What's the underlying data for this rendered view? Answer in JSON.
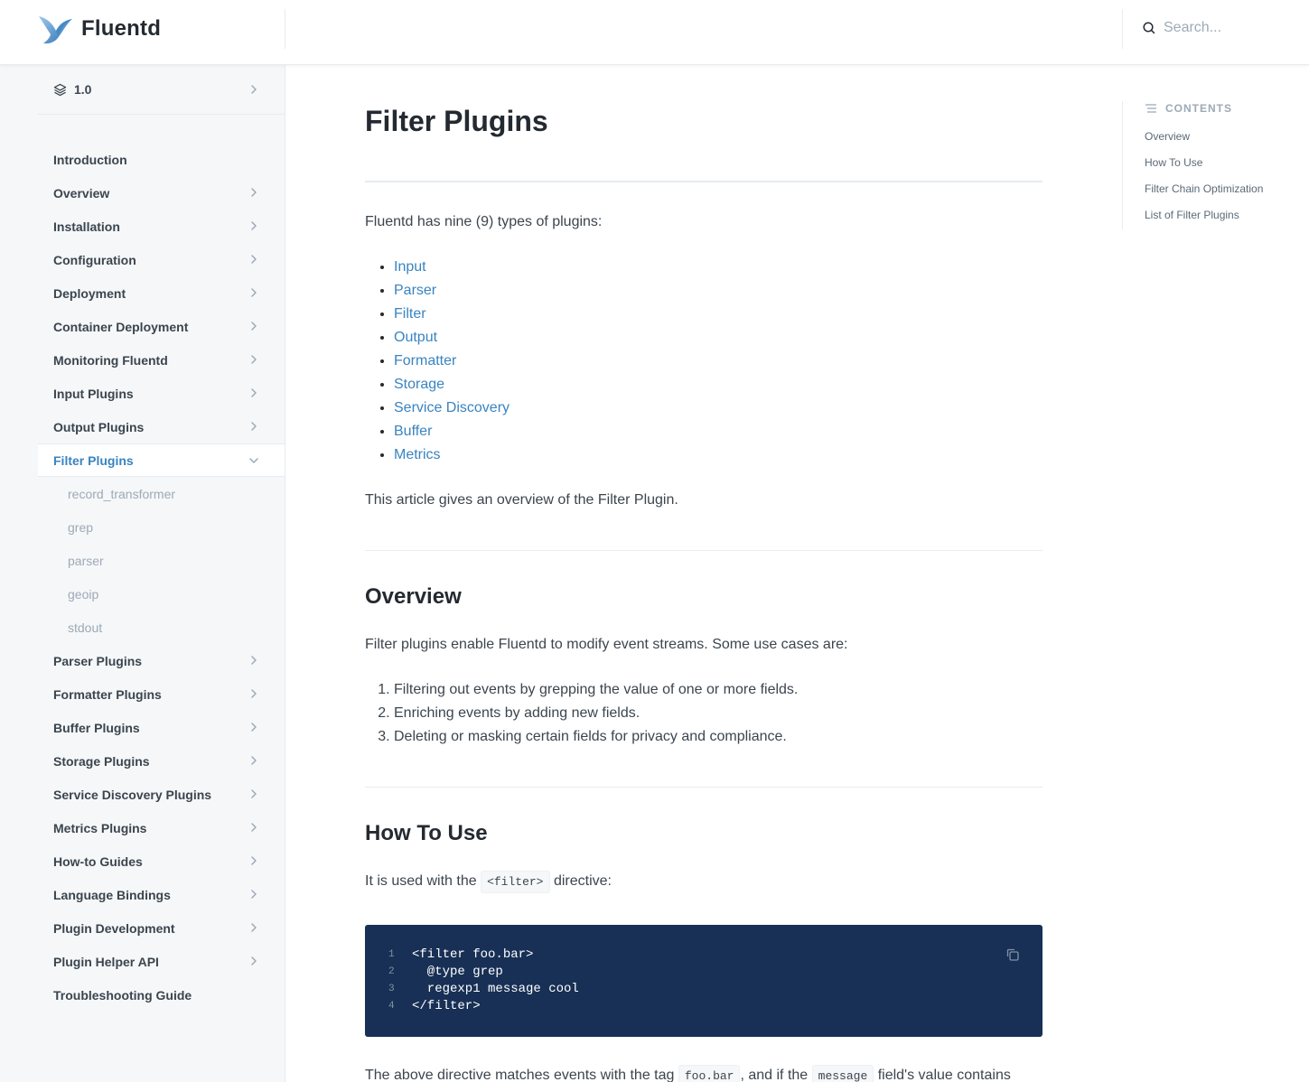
{
  "header": {
    "brand": "Fluentd",
    "search_placeholder": "Search..."
  },
  "sidebar": {
    "version": "1.0",
    "items": [
      {
        "label": "Introduction",
        "expandable": false
      },
      {
        "label": "Overview",
        "expandable": true
      },
      {
        "label": "Installation",
        "expandable": true
      },
      {
        "label": "Configuration",
        "expandable": true
      },
      {
        "label": "Deployment",
        "expandable": true
      },
      {
        "label": "Container Deployment",
        "expandable": true
      },
      {
        "label": "Monitoring Fluentd",
        "expandable": true
      },
      {
        "label": "Input Plugins",
        "expandable": true
      },
      {
        "label": "Output Plugins",
        "expandable": true
      },
      {
        "label": "Filter Plugins",
        "expandable": true,
        "active": true
      },
      {
        "label": "Parser Plugins",
        "expandable": true
      },
      {
        "label": "Formatter Plugins",
        "expandable": true
      },
      {
        "label": "Buffer Plugins",
        "expandable": true
      },
      {
        "label": "Storage Plugins",
        "expandable": true
      },
      {
        "label": "Service Discovery Plugins",
        "expandable": true
      },
      {
        "label": "Metrics Plugins",
        "expandable": true
      },
      {
        "label": "How-to Guides",
        "expandable": true
      },
      {
        "label": "Language Bindings",
        "expandable": true
      },
      {
        "label": "Plugin Development",
        "expandable": true
      },
      {
        "label": "Plugin Helper API",
        "expandable": true
      },
      {
        "label": "Troubleshooting Guide",
        "expandable": false
      }
    ],
    "subitems": [
      "record_transformer",
      "grep",
      "parser",
      "geoip",
      "stdout"
    ]
  },
  "main": {
    "title": "Filter Plugins",
    "intro": "Fluentd has nine (9) types of plugins:",
    "plugin_links": [
      "Input",
      "Parser",
      "Filter",
      "Output",
      "Formatter",
      "Storage",
      "Service Discovery",
      "Buffer",
      "Metrics"
    ],
    "article_note": "This article gives an overview of the Filter Plugin.",
    "overview": {
      "heading": "Overview",
      "text": "Filter plugins enable Fluentd to modify event streams. Some use cases are:",
      "cases": [
        "Filtering out events by grepping the value of one or more fields.",
        "Enriching events by adding new fields.",
        "Deleting or masking certain fields for privacy and compliance."
      ]
    },
    "how_to_use": {
      "heading": "How To Use",
      "text_before": "It is used with the",
      "directive": "<filter>",
      "text_after": "directive:",
      "code": [
        {
          "n": "1",
          "text": "<filter foo.bar>"
        },
        {
          "n": "2",
          "text": "  @type grep"
        },
        {
          "n": "3",
          "text": "  regexp1 message cool"
        },
        {
          "n": "4",
          "text": "</filter>"
        }
      ],
      "para2_a": "The above directive matches events with the tag",
      "para2_tag": "foo.bar",
      "para2_b": ", and if the",
      "para2_field": "message",
      "para2_c": "field's value contains"
    }
  },
  "toc": {
    "heading": "CONTENTS",
    "items": [
      "Overview",
      "How To Use",
      "Filter Chain Optimization",
      "List of Filter Plugins"
    ]
  }
}
